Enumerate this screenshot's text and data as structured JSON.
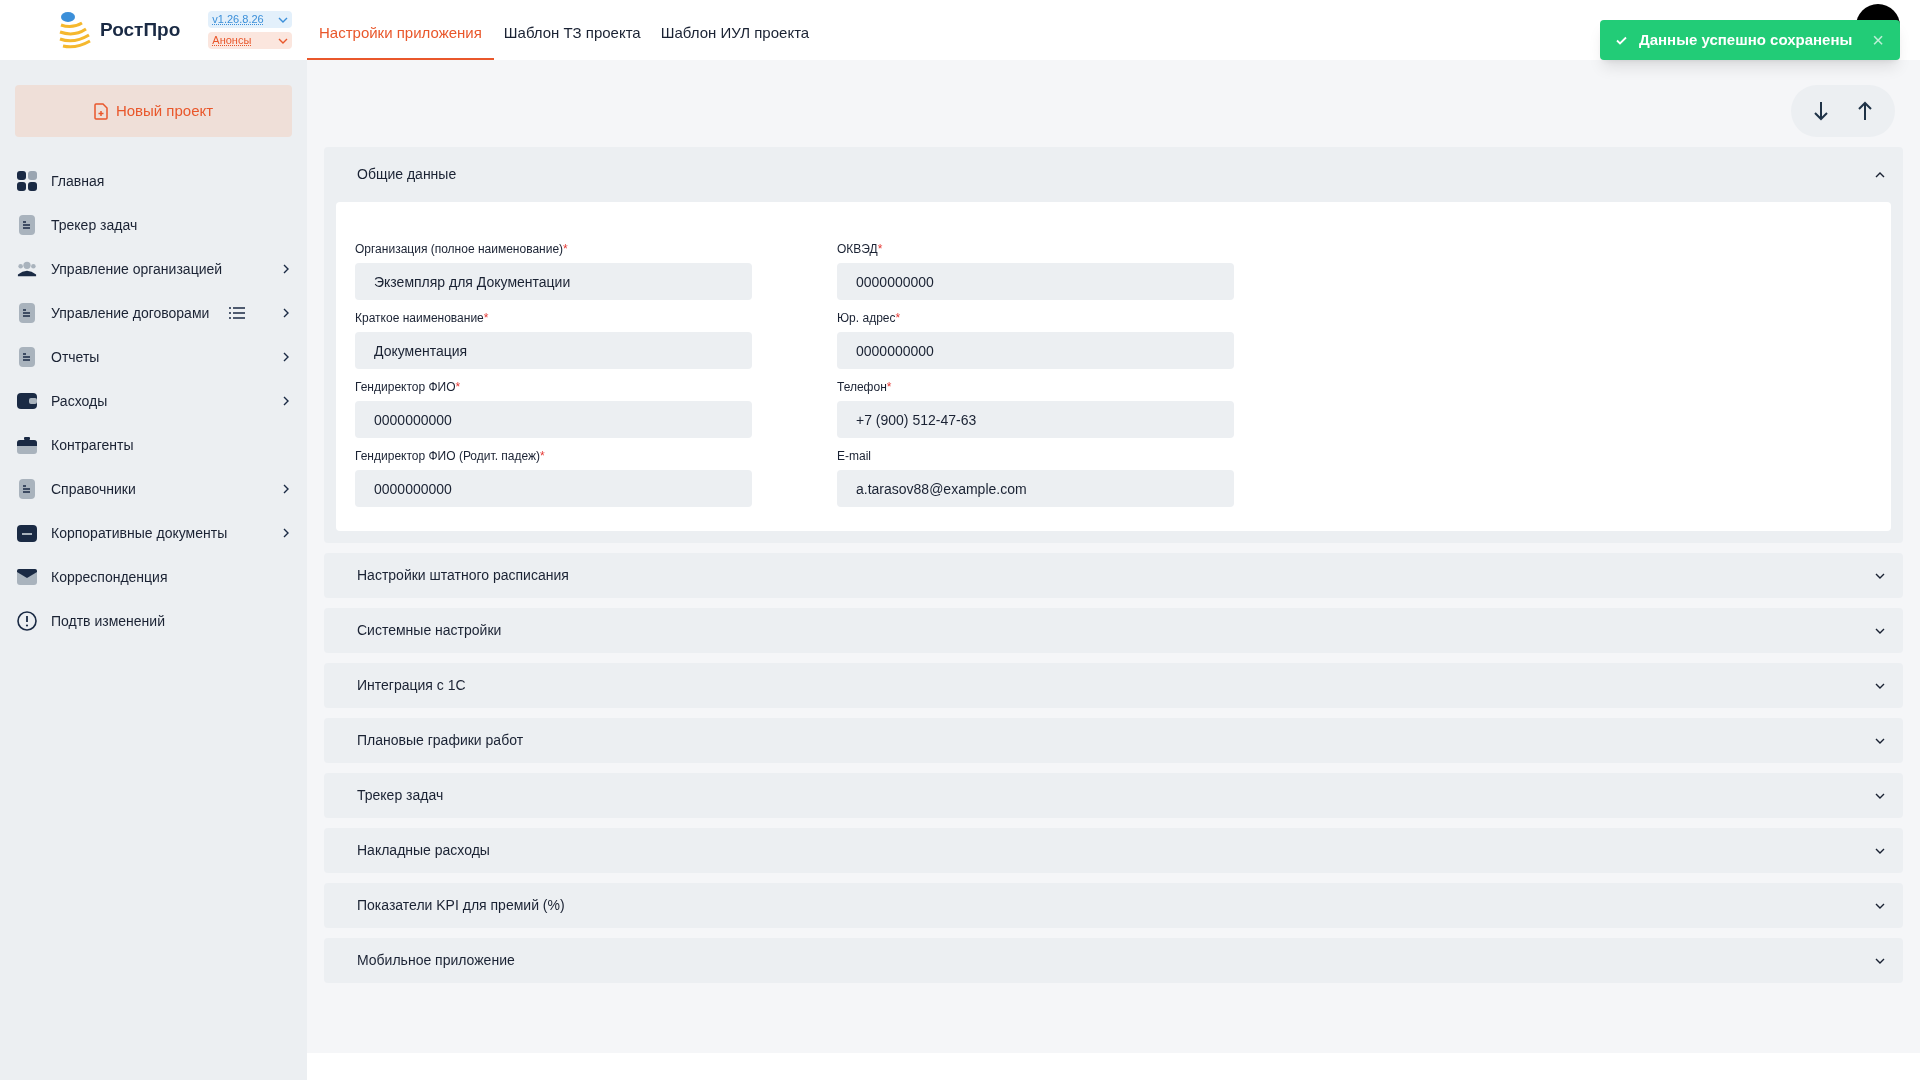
{
  "header": {
    "logo": "РостПро",
    "version": "v1.26.8.26",
    "announcements": "Анонсы",
    "tabs": [
      {
        "label": "Настройки приложения",
        "selected": true
      },
      {
        "label": "Шаблон ТЗ проекта",
        "selected": false
      },
      {
        "label": "Шаблон ИУЛ проекта",
        "selected": false
      }
    ]
  },
  "toast": {
    "message": "Данные успешно сохранены",
    "close": "×"
  },
  "sidebar": {
    "new_project": "Новый проект",
    "items": [
      {
        "label": "Главная",
        "kind": "grid",
        "has_submenu": false,
        "has_list": false
      },
      {
        "label": "Трекер задач",
        "kind": "doc",
        "has_submenu": false,
        "has_list": false
      },
      {
        "label": "Управление организацией",
        "kind": "people",
        "has_submenu": true,
        "has_list": false
      },
      {
        "label": "Управление договорами",
        "kind": "doc",
        "has_submenu": true,
        "has_list": true
      },
      {
        "label": "Отчеты",
        "kind": "doc",
        "has_submenu": true,
        "has_list": false
      },
      {
        "label": "Расходы",
        "kind": "wallet",
        "has_submenu": true,
        "has_list": false
      },
      {
        "label": "Контрагенты",
        "kind": "briefcase",
        "has_submenu": false,
        "has_list": false
      },
      {
        "label": "Справочники",
        "kind": "doc",
        "has_submenu": true,
        "has_list": false
      },
      {
        "label": "Корпоративные документы",
        "kind": "folder",
        "has_submenu": true,
        "has_list": false
      },
      {
        "label": "Корреспонденция",
        "kind": "mail",
        "has_submenu": false,
        "has_list": false
      },
      {
        "label": "Подтв изменений",
        "kind": "alert",
        "has_submenu": false,
        "has_list": false
      }
    ]
  },
  "sections": [
    {
      "title": "Общие данные",
      "expanded": true,
      "fields": [
        {
          "label": "Организация (полное наименование)",
          "required_mark": "*",
          "value": "Экземпляр для Документации"
        },
        {
          "label": "ОКВЭД",
          "required_mark": "*",
          "value": "0000000000"
        },
        {
          "label": "Краткое наименование",
          "required_mark": "*",
          "value": "Документация"
        },
        {
          "label": "Юр. адрес",
          "required_mark": "*",
          "value": "0000000000"
        },
        {
          "label": "Гендиректор ФИО",
          "required_mark": "*",
          "value": "0000000000"
        },
        {
          "label": "Телефон",
          "required_mark": "*",
          "value": "+7 (900) 512-47-63"
        },
        {
          "label": "Гендиректор ФИО (Родит. падеж)",
          "required_mark": "*",
          "value": "0000000000"
        },
        {
          "label": "E-mail",
          "value": "a.tarasov88@example.com"
        }
      ]
    },
    {
      "title": "Настройки штатного расписания",
      "expanded": false
    },
    {
      "title": "Системные настройки",
      "expanded": false
    },
    {
      "title": "Интеграция с 1С",
      "expanded": false
    },
    {
      "title": "Плановые графики работ",
      "expanded": false
    },
    {
      "title": "Трекер задач",
      "expanded": false
    },
    {
      "title": "Накладные расходы",
      "expanded": false
    },
    {
      "title": "Показатели KPI для премий (%)",
      "expanded": false
    },
    {
      "title": "Мобильное приложение",
      "expanded": false
    }
  ]
}
